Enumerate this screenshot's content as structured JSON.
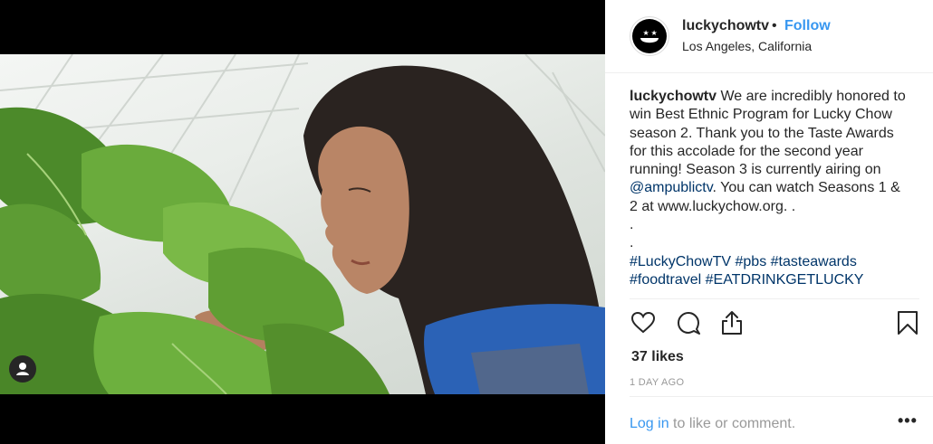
{
  "header": {
    "username": "luckychowtv",
    "separator": "•",
    "follow": "Follow",
    "location": "Los Angeles, California"
  },
  "caption": {
    "username": "luckychowtv",
    "text_part1": " We are incredibly honored to win Best Ethnic Program for Lucky Chow season 2. Thank you to the Taste Awards for this accolade for the second year running! Season 3 is currently airing on ",
    "mention": "@ampublictv",
    "text_part2": ". You can watch Seasons 1 & 2 at www.luckychow.org. .",
    "dot1": ".",
    "dot2": ".",
    "hashtags": [
      "#LuckyChowTV",
      "#pbs",
      "#tasteawards",
      "#foodtravel",
      "#EATDRINKGETLUCKY"
    ]
  },
  "icons": {
    "like": "heart-icon",
    "comment": "comment-icon",
    "share": "share-icon",
    "save": "bookmark-icon",
    "user_tag": "user-icon",
    "more": "more-options-icon"
  },
  "likes": "37 likes",
  "time": "1 DAY AGO",
  "comment_prompt": {
    "login": "Log in",
    "rest": " to like or comment."
  },
  "more": "•••",
  "colors": {
    "accent": "#3897f0",
    "link": "#003569",
    "text": "#262626",
    "muted": "#999999"
  }
}
